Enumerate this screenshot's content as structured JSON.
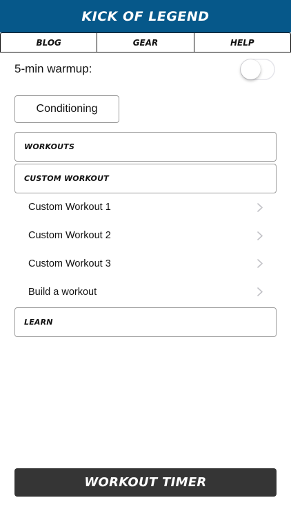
{
  "header": {
    "title": "Kick of Legend",
    "color": "#06588a"
  },
  "tabs": [
    {
      "label": "Blog"
    },
    {
      "label": "Gear"
    },
    {
      "label": "Help"
    }
  ],
  "warmup": {
    "label": "5-min warmup:",
    "enabled": false
  },
  "conditioning": {
    "label": "Conditioning"
  },
  "sections": {
    "workouts": {
      "label": "Workouts"
    },
    "custom_workout": {
      "label": "Custom Workout",
      "items": [
        {
          "label": "Custom Workout 1",
          "icon": "chevron-right-icon"
        },
        {
          "label": "Custom Workout 2",
          "icon": "chevron-right-icon"
        },
        {
          "label": "Custom Workout 3",
          "icon": "chevron-right-icon"
        },
        {
          "label": "Build a workout",
          "icon": "chevron-right-icon"
        }
      ]
    },
    "learn": {
      "label": "Learn"
    }
  },
  "footer": {
    "timer_label": "Workout Timer",
    "color": "#353535"
  }
}
